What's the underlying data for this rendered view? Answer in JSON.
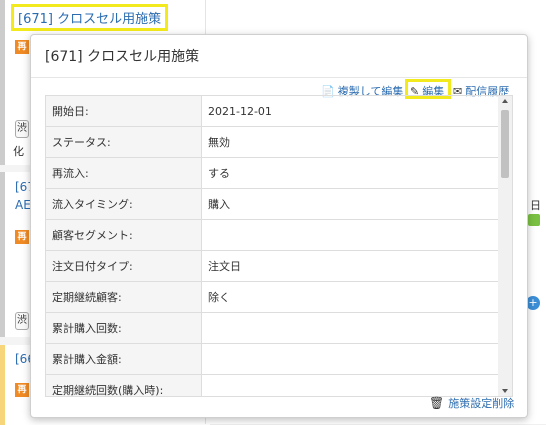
{
  "background": {
    "top_link": "[671] クロスセル用施策",
    "badge": "再",
    "card2_link_line1": "[67",
    "card2_link_line2": "AE",
    "card3_link": "[66",
    "side_text": "化",
    "small_btn": "渋",
    "right_text": "日"
  },
  "popup": {
    "title": "[671] クロスセル用施策",
    "actions": {
      "copy_edit": "複製して編集",
      "edit": "編集",
      "delivery_history": "配信履歴"
    },
    "rows": [
      {
        "label": "開始日:",
        "value": "2021-12-01"
      },
      {
        "label": "ステータス:",
        "value": "無効"
      },
      {
        "label": "再流入:",
        "value": "する"
      },
      {
        "label": "流入タイミング:",
        "value": "購入"
      },
      {
        "label": "顧客セグメント:",
        "value": ""
      },
      {
        "label": "注文日付タイプ:",
        "value": "注文日"
      },
      {
        "label": "定期継続顧客:",
        "value": "除く"
      },
      {
        "label": "累計購入回数:",
        "value": ""
      },
      {
        "label": "累計購入金額:",
        "value": ""
      },
      {
        "label": "定期継続回数(購入時):",
        "value": ""
      }
    ],
    "delete_label": "施策設定削除"
  },
  "colors": {
    "link": "#2b6cb0",
    "highlight": "#f2ea1c",
    "badge": "#f08a24"
  }
}
